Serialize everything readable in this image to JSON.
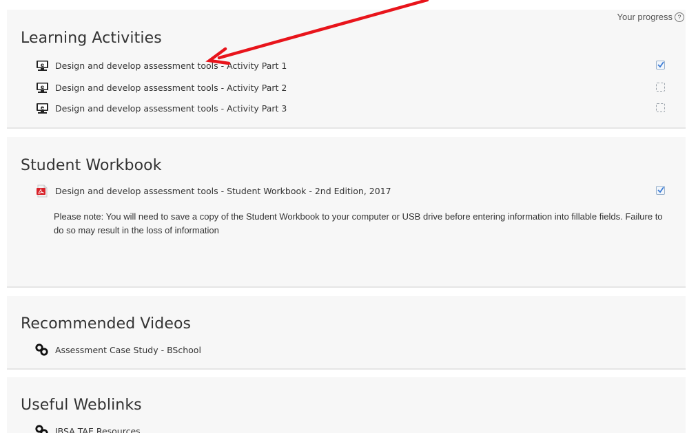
{
  "progress": {
    "label": "Your progress",
    "help_icon": "help-circle-icon"
  },
  "learning_activities": {
    "title": "Learning Activities",
    "items": [
      {
        "label": "Design and develop assessment tools - Activity Part 1",
        "icon": "elearning-monitor-icon",
        "completed": true
      },
      {
        "label": "Design and develop assessment tools - Activity Part 2",
        "icon": "elearning-monitor-icon",
        "completed": false
      },
      {
        "label": "Design and develop assessment tools - Activity Part 3",
        "icon": "elearning-monitor-icon",
        "completed": false
      }
    ]
  },
  "student_workbook": {
    "title": "Student Workbook",
    "items": [
      {
        "label": "Design and develop assessment tools - Student Workbook - 2nd Edition, 2017",
        "icon": "pdf-icon",
        "completed": true
      }
    ],
    "note": "Please note: You will need to save a copy of the Student Workbook to your computer or USB drive before entering information into fillable fields. Failure to do so may result in the loss of information"
  },
  "recommended_videos": {
    "title": "Recommended Videos",
    "items": [
      {
        "label": "Assessment Case Study - BSchool",
        "icon": "url-link-icon"
      }
    ]
  },
  "useful_weblinks": {
    "title": "Useful Weblinks",
    "items": [
      {
        "label": "IBSA TAE Resources",
        "icon": "url-link-icon"
      }
    ]
  },
  "colors": {
    "section_bg": "#f7f7f7",
    "annotation_arrow": "#e8141b",
    "text": "#333333"
  }
}
